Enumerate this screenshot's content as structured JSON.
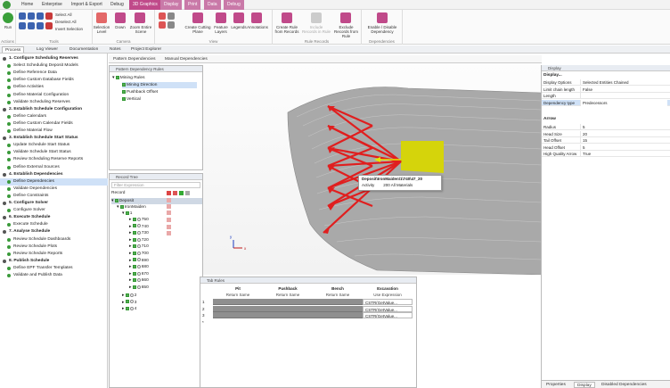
{
  "menubar": {
    "tabs": [
      "Home",
      "Enterprise",
      "Import & Export",
      "Debug",
      "3D Graphics",
      "Display",
      "Print",
      "Data",
      "Debug"
    ]
  },
  "ribbon": {
    "run_label": "Run",
    "actions_group": "Actions",
    "select_all": "Select All",
    "deselect_all": "Deselect All",
    "invert_selection": "Invert Selection",
    "tools_group": "Tools",
    "selection_level": "Selection Level",
    "down": "Down",
    "zoom_entire_scene": "Zoom Entire Scene",
    "camera_group": "Camera",
    "create_cutting_plane": "Create Cutting Plane",
    "feature_layers": "Feature Layers",
    "legends": "Legends",
    "annotations": "Annotations",
    "view_group": "View",
    "create_rule_from_records": "Create Rule from Records",
    "include_records_in_rule": "Include Records in Rule",
    "exclude_records_from_rule": "Exclude Records from Rule",
    "rule_records_group": "Rule Records",
    "enable_disable_dependency": "Enable / Disable Dependency",
    "dependencies_group": "Dependencies"
  },
  "doc_tabs": [
    "Process",
    "Log Viewer",
    "Documentation",
    "Notes",
    "Project Explorer"
  ],
  "process": {
    "items": [
      {
        "t": "1. Configure Scheduling Reserves",
        "h": true
      },
      {
        "t": "Select Scheduling Deposit Models"
      },
      {
        "t": "Define Reference Data"
      },
      {
        "t": "Define Custom Database Fields"
      },
      {
        "t": "Define Activities"
      },
      {
        "t": "Define Material Configuration"
      },
      {
        "t": "Validate Scheduling Reserves"
      },
      {
        "t": "2. Establish Schedule Configuration",
        "h": true
      },
      {
        "t": "Define Calendars"
      },
      {
        "t": "Define Custom Calendar Fields"
      },
      {
        "t": "Define Material Flow"
      },
      {
        "t": "3. Establish Schedule Start Status",
        "h": true
      },
      {
        "t": "Update Schedule Start Status"
      },
      {
        "t": "Validate Schedule Start Status"
      },
      {
        "t": "Review Scheduling Reserve Reports"
      },
      {
        "t": "Define External Sources"
      },
      {
        "t": "4. Establish Dependencies",
        "h": true
      },
      {
        "t": "Define Dependencies",
        "sel": true
      },
      {
        "t": "Validate Dependencies"
      },
      {
        "t": "Define Constraints"
      },
      {
        "t": "5. Configure Solver",
        "h": true
      },
      {
        "t": "Configure Solver"
      },
      {
        "t": "6. Execute Schedule",
        "h": true
      },
      {
        "t": "Execute Schedule"
      },
      {
        "t": "7. Analyse Schedule",
        "h": true
      },
      {
        "t": "Review Schedule Dashboards"
      },
      {
        "t": "Review Schedule Plots"
      },
      {
        "t": "Review Schedule Reports"
      },
      {
        "t": "8. Publish Schedule",
        "h": true
      },
      {
        "t": "Define EPF Transfer Templates"
      },
      {
        "t": "Validate and Publish Data"
      }
    ]
  },
  "subtabs": [
    "Pattern Dependencies",
    "Manual Dependencies"
  ],
  "pattern_rules": {
    "title": "Pattern Dependency Rules",
    "root": "Mining Rules",
    "children": [
      "Mining Direction",
      "Pushback Offset",
      "Vertical"
    ]
  },
  "record_tree": {
    "title": "Record Tree",
    "filter_placeholder": "Filter Expression",
    "column": "Record",
    "deposit": "Deposit",
    "ironmaiden": "IronMaiden",
    "n1": "1",
    "benches": [
      "750",
      "740",
      "730",
      "720",
      "710",
      "700",
      "690",
      "680",
      "670",
      "660",
      "650"
    ],
    "others": [
      "2",
      "3",
      "4"
    ]
  },
  "viewport": {
    "tooltip_title": "Deposit\\IronMaiden\\1\\740\\47_20",
    "tooltip_label": "Activity",
    "tooltip_value": "200 All Materials",
    "axis_x": "x",
    "axis_y": "y"
  },
  "tab_rules": {
    "title": "Tab Rules",
    "headers": [
      "Pit",
      "Pushback",
      "Bench",
      "Excavation"
    ],
    "subheaders": [
      "Return Same",
      "Return Same",
      "Return Same",
      "Use Expression"
    ],
    "rows": [
      "1",
      "2",
      "3",
      "*"
    ],
    "exprs": [
      "CSTR(GetValue...",
      "CSTR(GetValue...",
      "CSTR(GetValue..."
    ]
  },
  "props": {
    "title": "Display",
    "section1": "Display...",
    "rows1": [
      {
        "k": "Display Options",
        "v": "Selected Entities Chained"
      },
      {
        "k": "Limit chain length",
        "v": "False"
      },
      {
        "k": "Length",
        "v": ""
      },
      {
        "k": "Dependency type",
        "v": "Predecessors",
        "sel": true
      }
    ],
    "section2": "Arrow",
    "rows2": [
      {
        "k": "Radius",
        "v": "5"
      },
      {
        "k": "Head Size",
        "v": "20"
      },
      {
        "k": "Tail Offset",
        "v": "15"
      },
      {
        "k": "Head Offset",
        "v": "5"
      },
      {
        "k": "High Quality Arrow",
        "v": "True"
      }
    ],
    "bottom_tabs": [
      "Properties",
      "Display",
      "Disabled Dependencies"
    ]
  },
  "colors": {
    "accent": "#c04a8a",
    "ribbon_tab": "#c979a8",
    "selection": "#cfe1f7",
    "arrow": "#e01f1f",
    "block": "#d5d40b"
  }
}
